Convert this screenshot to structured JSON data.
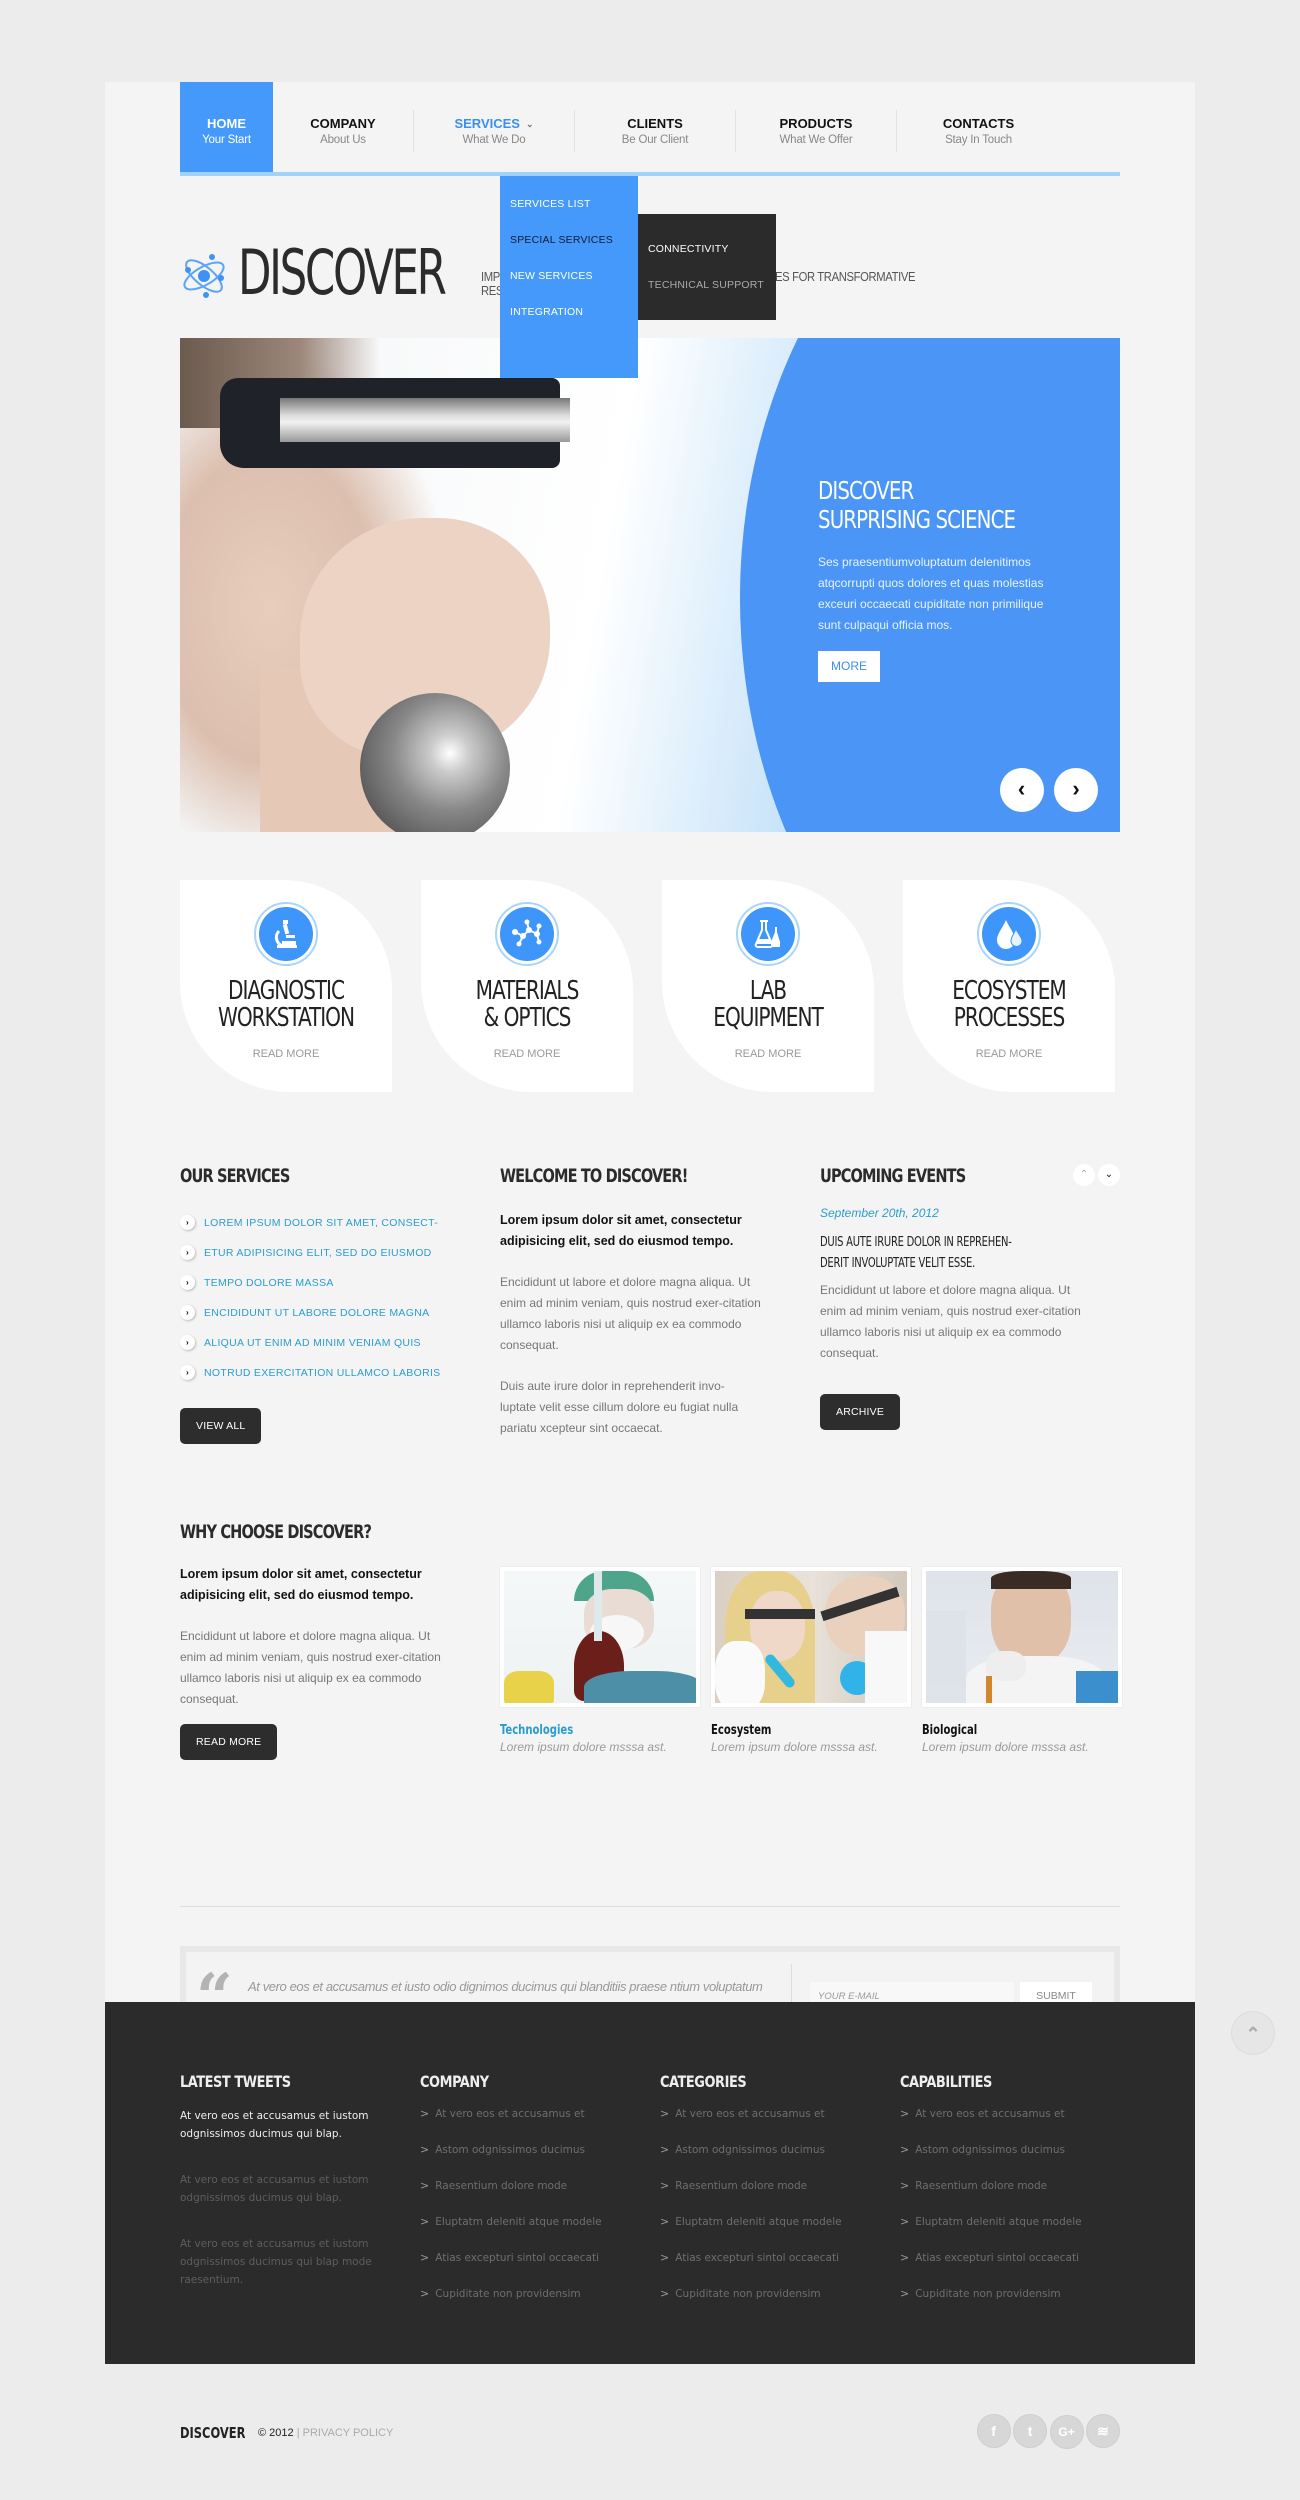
{
  "nav": {
    "items": [
      {
        "title": "HOME",
        "subtitle": "Your Start"
      },
      {
        "title": "COMPANY",
        "subtitle": "About Us"
      },
      {
        "title": "SERVICES",
        "subtitle": "What We Do"
      },
      {
        "title": "CLIENTS",
        "subtitle": "Be Our Client"
      },
      {
        "title": "PRODUCTS",
        "subtitle": "What We Offer"
      },
      {
        "title": "CONTACTS",
        "subtitle": "Stay In Touch"
      }
    ],
    "active": "HOME",
    "open": "SERVICES",
    "services_dropdown": [
      "SERVICES LIST",
      "SPECIAL SERVICES",
      "NEW SERVICES",
      "INTEGRATION"
    ],
    "special_submenu": [
      "CONNECTIVITY",
      "TECHNICAL SUPPORT"
    ]
  },
  "logo": {
    "text": "DISCOVER",
    "tagline_line1": "IMPROVING RESEARCH AND DEVELOPING TECHNOLOGIES FOR TRANSFORMATIVE",
    "tagline_line2": "RESEARCH AND FUTURE GENERATIONS"
  },
  "hero": {
    "title_line1": "DISCOVER",
    "title_line2": "SURPRISING SCIENCE",
    "text": "Ses praesentiumvoluptatum delenitimos atqcorrupti quos dolores et quas molestias exceuri occaecati cupiditate non primilique sunt  culpaqui officia mos.",
    "button": "MORE",
    "prev_icon": "‹",
    "next_icon": "›"
  },
  "features": [
    {
      "icon": "microscope-icon",
      "line1": "DIAGNOSTIC",
      "line2": "WORKSTATION",
      "link": "READ MORE"
    },
    {
      "icon": "molecule-icon",
      "line1": "MATERIALS",
      "line2": "& OPTICS",
      "link": "READ MORE"
    },
    {
      "icon": "flask-icon",
      "line1": "LAB",
      "line2": "EQUIPMENT",
      "link": "READ MORE"
    },
    {
      "icon": "water-drops-icon",
      "line1": "ECOSYSTEM",
      "line2": "PROCESSES",
      "link": "READ MORE"
    }
  ],
  "services": {
    "heading": "OUR SERVICES",
    "items": [
      "LOREM IPSUM DOLOR SIT AMET, CONSECT-",
      "ETUR ADIPISICING ELIT, SED DO EIUSMOD",
      "TEMPO DOLORE MASSA",
      "ENCIDIDUNT UT LABORE DOLORE MAGNA",
      "ALIQUA UT ENIM AD MINIM VENIAM QUIS",
      "NOTRUD EXERCITATION ULLAMCO LABORIS"
    ],
    "button": "VIEW ALL"
  },
  "welcome": {
    "heading": "WELCOME TO DISCOVER!",
    "lead": "Lorem ipsum dolor sit amet, consectetur adipisicing elit, sed do eiusmod tempo.",
    "p1": "Encididunt ut labore et dolore magna aliqua. Ut enim ad minim veniam, quis nostrud exer-citation ullamco laboris nisi ut aliquip ex ea commodo consequat.",
    "p2": "Duis aute irure dolor in reprehenderit invo-luptate velit esse cillum dolore eu fugiat nulla pariatu xcepteur sint occaecat."
  },
  "events": {
    "heading": "UPCOMING EVENTS",
    "date": "September 20th, 2012",
    "title_line1": "DUIS AUTE IRURE DOLOR IN REPREHEN-",
    "title_line2": "DERIT INVOLUPTATE VELIT ESSE.",
    "text": "Encididunt ut labore et dolore magna aliqua. Ut enim ad minim veniam, quis nostrud exer-citation ullamco laboris nisi ut aliquip ex ea commodo consequat.",
    "button": "ARCHIVE"
  },
  "why": {
    "heading": "WHY CHOOSE DISCOVER?",
    "lead": "Lorem ipsum dolor sit amet, consectetur adipisicing elit, sed do eiusmod tempo.",
    "text": "Encididunt ut labore et dolore magna aliqua. Ut enim ad minim veniam, quis nostrud exer-citation ullamco laboris nisi ut aliquip ex ea commodo consequat.",
    "button": "READ MORE"
  },
  "gallery": [
    {
      "title": "Technologies",
      "subtitle": "Lorem ipsum dolore msssa ast."
    },
    {
      "title": "Ecosystem",
      "subtitle": "Lorem ipsum dolore msssa ast."
    },
    {
      "title": "Biological",
      "subtitle": "Lorem ipsum dolore msssa ast."
    }
  ],
  "newsletter": {
    "quote": "At vero eos et accusamus et iusto odio dignimos ducimus qui blanditiis praese ntium voluptatum deleniti atque. Errupti quos dolores et quas...",
    "email_placeholder": "YOUR E-MAIL",
    "button": "SUBMIT"
  },
  "footer": {
    "tweets_heading": "LATEST TWEETS",
    "tweets": [
      "At vero eos et accusamus et iustom odgnissimos ducimus qui blap.",
      "At vero eos et accusamus et iustom odgnissimos ducimus qui blap.",
      "At vero eos et accusamus et iustom odgnissimos ducimus qui blap mode raesentium."
    ],
    "columns": [
      {
        "heading": "COMPANY",
        "items": [
          "At vero eos et accusamus et",
          "Astom odgnissimos ducimus",
          "Raesentium dolore mode",
          "Eluptatm deleniti atque modele",
          "Atias excepturi sintol occaecati",
          "Cupiditate non providensim"
        ]
      },
      {
        "heading": "CATEGORIES",
        "items": [
          "At vero eos et accusamus et",
          "Astom odgnissimos ducimus",
          "Raesentium dolore mode",
          "Eluptatm deleniti atque modele",
          "Atias excepturi sintol occaecati",
          "Cupiditate non providensim"
        ]
      },
      {
        "heading": "CAPABILITIES",
        "items": [
          "At vero eos et accusamus et",
          "Astom odgnissimos ducimus",
          "Raesentium dolore mode",
          "Eluptatm deleniti atque modele",
          "Atias excepturi sintol occaecati",
          "Cupiditate non providensim"
        ]
      }
    ]
  },
  "bottom": {
    "brand": "DISCOVER",
    "copyright": "© 2012",
    "separator": "|",
    "privacy": "PRIVACY POLICY",
    "social": [
      {
        "name": "facebook-icon",
        "glyph": "f"
      },
      {
        "name": "twitter-icon",
        "glyph": "t"
      },
      {
        "name": "google-plus-icon",
        "glyph": "G+"
      },
      {
        "name": "rss-icon",
        "glyph": "≋"
      }
    ]
  },
  "colors": {
    "accent": "#4599fb",
    "link": "#2a9dce",
    "dark": "#2b2b2b",
    "nav_underline": "#9fd3f9"
  }
}
